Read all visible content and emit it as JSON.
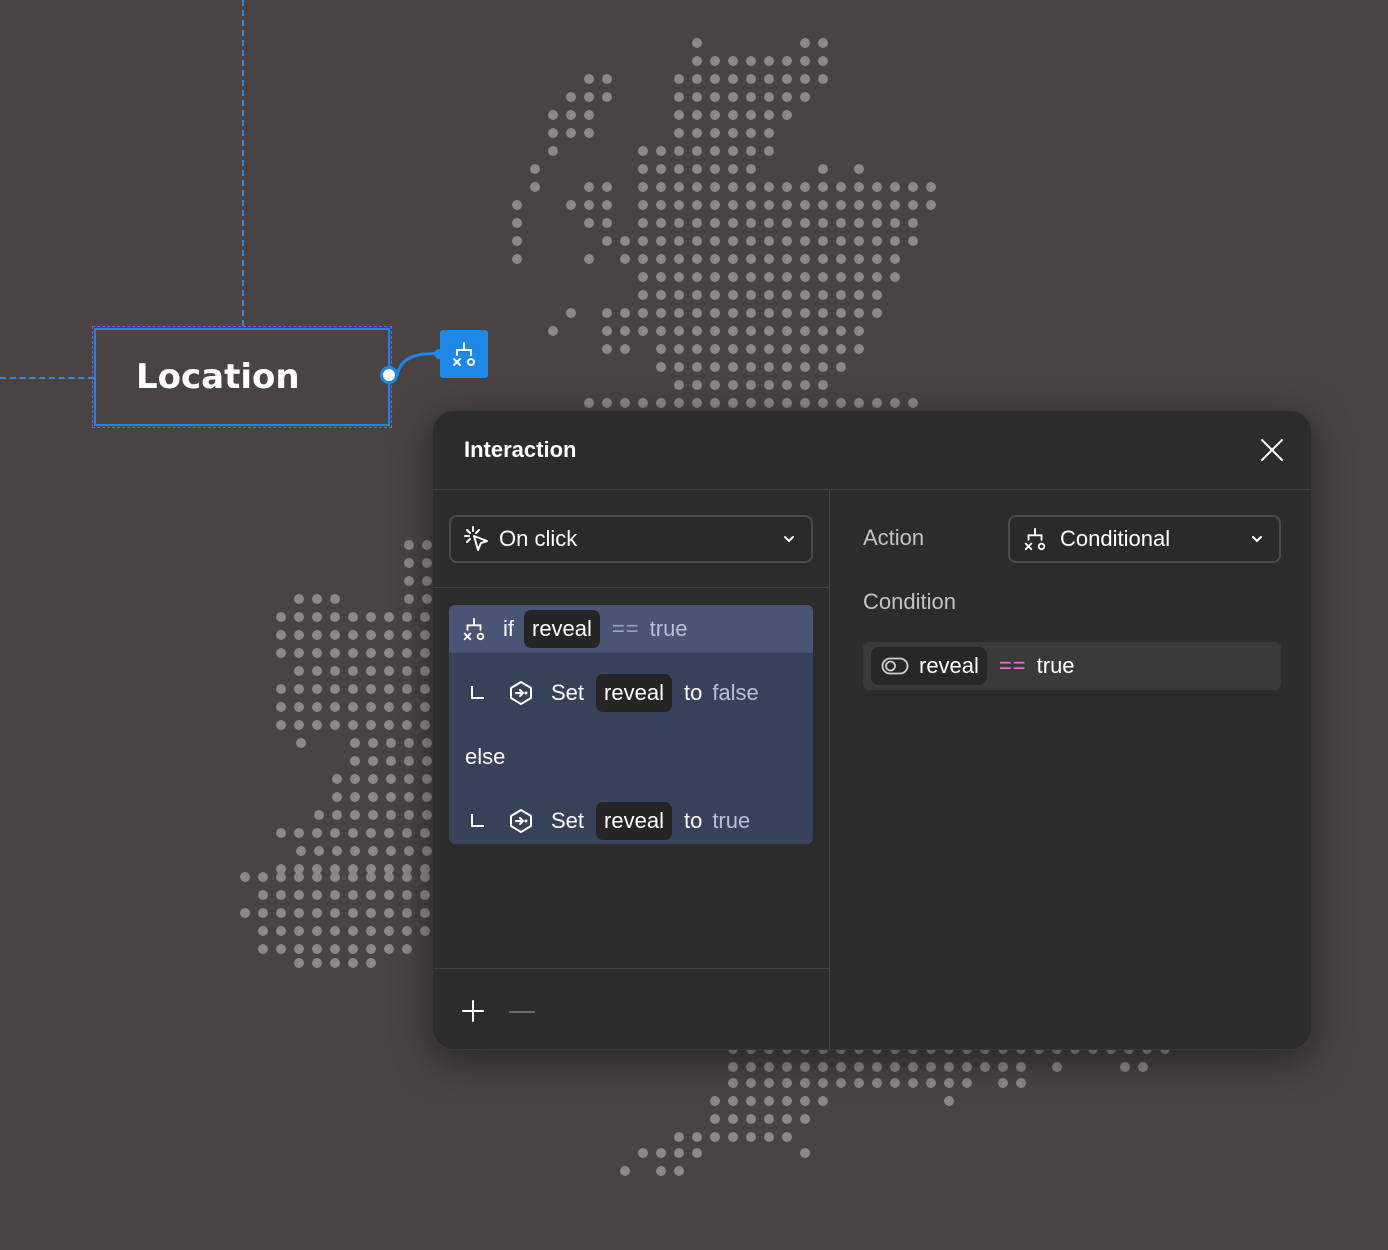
{
  "canvas": {
    "node_label": "Location"
  },
  "panel": {
    "title": "Interaction",
    "trigger": {
      "label": "On click"
    },
    "logic": {
      "if_keyword": "if",
      "condition": {
        "variable": "reveal",
        "operator": "==",
        "value": "true"
      },
      "then": {
        "verb": "Set",
        "variable": "reveal",
        "to": "to",
        "value": "false"
      },
      "else_keyword": "else",
      "else_branch": {
        "verb": "Set",
        "variable": "reveal",
        "to": "to",
        "value": "true"
      }
    },
    "action": {
      "label": "Action",
      "selected": "Conditional"
    },
    "condition_section": {
      "label": "Condition",
      "variable": "reveal",
      "operator": "==",
      "value": "true"
    }
  },
  "colors": {
    "canvas_bg": "#494343",
    "dot": "#8d8787",
    "selection_blue": "#1e86e6",
    "panel_bg": "#2d2c2c",
    "logic_block": "#38415a",
    "logic_highlight": "#4a5576",
    "operator_pink": "#e873d8"
  },
  "icons": {
    "node_badge": "conditional-branch-icon",
    "trigger": "click-cursor-icon",
    "set_variable": "set-variable-icon",
    "toggle": "toggle-icon",
    "close": "close-icon",
    "add": "plus-icon",
    "remove": "minus-icon",
    "dropdown": "chevron-down-icon"
  }
}
